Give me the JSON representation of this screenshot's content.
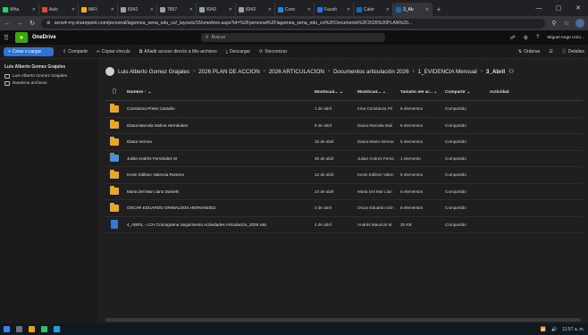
{
  "tabs": [
    {
      "label": "Wha",
      "color": "#25d366"
    },
    {
      "label": "Autc",
      "color": "#ea4335"
    },
    {
      "label": "MiFt",
      "color": "#f4b400"
    },
    {
      "label": "8342",
      "color": "#9aa0a6"
    },
    {
      "label": "7857",
      "color": "#9aa0a6"
    },
    {
      "label": "8342",
      "color": "#9aa0a6"
    },
    {
      "label": "8342",
      "color": "#9aa0a6"
    },
    {
      "label": "Conc",
      "color": "#1e88e5"
    },
    {
      "label": "Faceb",
      "color": "#1877f2"
    },
    {
      "label": "Calor",
      "color": "#0f6cbd"
    },
    {
      "label": "3_Ab",
      "color": "#0f6cbd"
    }
  ],
  "address": {
    "url": "sena4-my.sharepoint.com/personal/lagomea_sena_edu_co/_layouts/15/onedrive.aspx?id=%2Fpersonal%2Flagomea_sena_edu_co%2FDocuments%2F2026%20PLAN%20..."
  },
  "sharepoint": {
    "app_name": "OneDrive",
    "search_placeholder": "Buscar",
    "user_name": "Miguel Ange Unio..."
  },
  "commands": {
    "create": "Crear o cargar",
    "share": "Compartir",
    "copy_link": "Copiar vínculo",
    "add_shortcut": "Añadir acceso directo a Mis archivos",
    "download": "Descargar",
    "sync": "Sincronizar",
    "sort": "Ordenar",
    "details": "Detalles"
  },
  "sidebar": {
    "owner": "Luis Alberto Gomez Grajales",
    "items": [
      {
        "label": "Luis Alberto Gomez Grajales"
      },
      {
        "label": "Nuestros archivos"
      }
    ]
  },
  "breadcrumb": {
    "items": [
      "Luis Alberto Gomez Grajales",
      "2026 PLAN DE ACCION",
      "2026 ARTICULACION",
      "Documentos articulación 2026",
      "1_EVIDENCIA Mensual",
      "3_Abril"
    ]
  },
  "table": {
    "headers": {
      "name": "Nombre",
      "modified": "Modificad...",
      "modified_by": "Modificad...",
      "size": "Tamaño del ar...",
      "sharing": "Compartir",
      "activity": "Actividad"
    },
    "rows": [
      {
        "icon": "folder",
        "name": "Constanza Prieto Castaño",
        "modified": "1 de abril",
        "modified_by": "Irma Constanza Pri",
        "size": "6 elementos",
        "sharing": "Compartido"
      },
      {
        "icon": "folder",
        "name": "Diana Marcela Molina Hernández",
        "modified": "9 de abril",
        "modified_by": "Diana Marcela Moli",
        "size": "6 elementos",
        "sharing": "Compartido"
      },
      {
        "icon": "folder",
        "name": "Diana Verona",
        "modified": "15 de abril",
        "modified_by": "Diana Maria Verona",
        "size": "5 elementos",
        "sharing": "Compartido"
      },
      {
        "icon": "folder-blue",
        "name": "Julián Andrés Fernández M",
        "modified": "30 de abril",
        "modified_by": "Julian Andres Ferna",
        "size": "1 elemento",
        "sharing": "Compartido"
      },
      {
        "icon": "folder",
        "name": "Kevin Edilson Valencia Romero",
        "modified": "12 de abril",
        "modified_by": "Kevin Edilson Valen",
        "size": "6 elementos",
        "sharing": "Compartido"
      },
      {
        "icon": "folder",
        "name": "Maria Del Mar Llano Daniels",
        "modified": "24 de abril",
        "modified_by": "Maria Del Mar Llan",
        "size": "5 elementos",
        "sharing": "Compartido"
      },
      {
        "icon": "folder",
        "name": "OSCAR EDUARDO GRIMALDOS HERNANDEZ",
        "modified": "3 de abril",
        "modified_by": "Oscar Eduardo Grin",
        "size": "8 elementos",
        "sharing": "Compartido"
      },
      {
        "icon": "file",
        "name": "4_ABRIL - LCH Cronograma Seguimiento Actividades Articulación_2026.xlsx",
        "modified": "4 de abril",
        "modified_by": "Andrés Mauricio M",
        "size": "30 KB",
        "sharing": "Compartido"
      }
    ]
  },
  "taskbar": {
    "time": "11:57 a. m."
  }
}
